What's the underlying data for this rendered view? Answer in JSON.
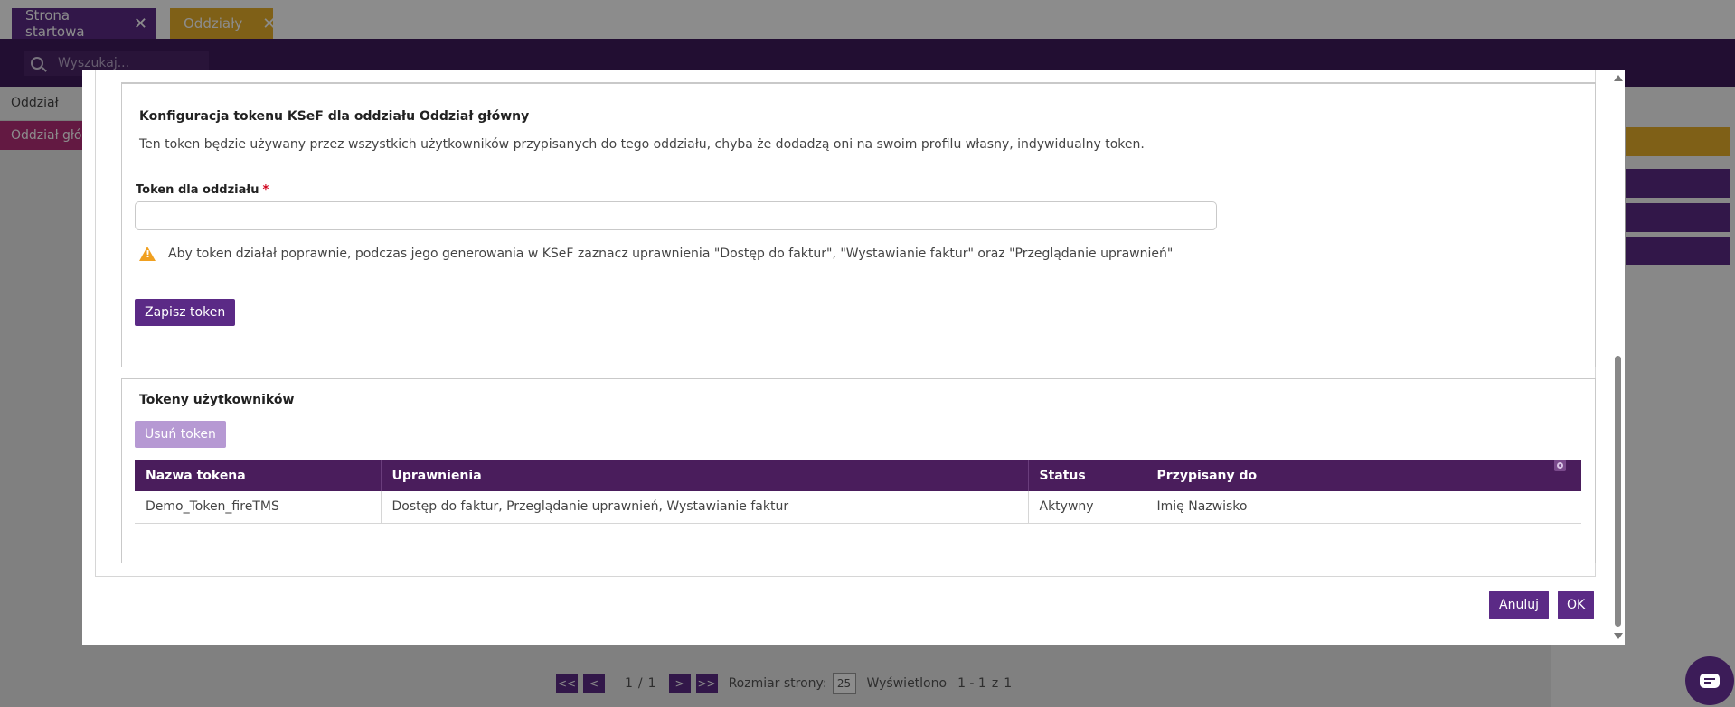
{
  "tabs": [
    {
      "label": "Strona startowa"
    },
    {
      "label": "Oddziały"
    }
  ],
  "search": {
    "placeholder": "Wyszukaj..."
  },
  "subheader": {
    "label": "Oddział"
  },
  "selected_row": {
    "label": "Oddział główny"
  },
  "pager": {
    "first": "<<",
    "prev": "<",
    "page": "1",
    "separator": "/",
    "total_pages": "1",
    "next": ">",
    "last": ">>",
    "page_size_label": "Rozmiar strony:",
    "page_size": "25",
    "shown_label": "Wyświetlono",
    "shown_range": "1 - 1",
    "of_label": "z",
    "total": "1"
  },
  "modal": {
    "token_section": {
      "title": "Konfiguracja tokenu KSeF dla oddziału Oddział główny",
      "description": "Ten token będzie używany przez wszystkich użytkowników przypisanych do tego oddziału, chyba że dodadzą oni na swoim profilu własny, indywidualny token.",
      "field_label": "Token dla oddziału",
      "required_mark": "*",
      "field_value": "",
      "warning": "Aby token działał poprawnie, podczas jego generowania w KSeF zaznacz uprawnienia \"Dostęp do faktur\", \"Wystawianie faktur\" oraz \"Przeglądanie uprawnień\"",
      "save_label": "Zapisz token"
    },
    "users_section": {
      "title": "Tokeny użytkowników",
      "delete_label": "Usuń token",
      "columns": [
        "Nazwa tokena",
        "Uprawnienia",
        "Status",
        "Przypisany do"
      ],
      "rows": [
        [
          "Demo_Token_fireTMS",
          "Dostęp do faktur, Przeglądanie uprawnień, Wystawianie faktur",
          "Aktywny",
          "Imię Nazwisko"
        ]
      ]
    },
    "cancel_label": "Anuluj",
    "ok_label": "OK"
  },
  "colors": {
    "primary": "#5b2a86",
    "table_header": "#4a1d5c",
    "accent_tab": "#e8b02a",
    "selected_row": "#b42f79",
    "warning": "#f0a020"
  }
}
